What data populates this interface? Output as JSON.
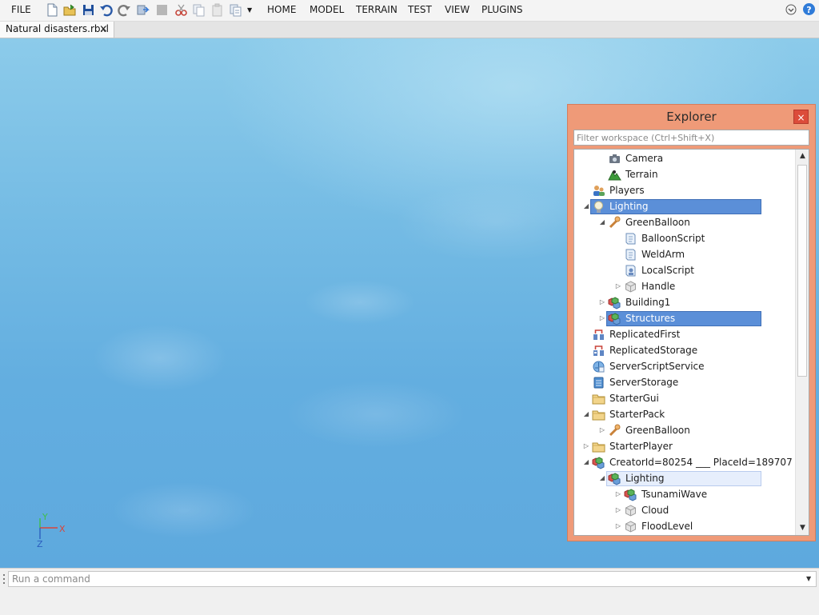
{
  "menubar": {
    "file": "FILE",
    "tabs": [
      "HOME",
      "MODEL",
      "TERRAIN",
      "TEST",
      "VIEW",
      "PLUGINS"
    ],
    "icons": [
      "new-file-icon",
      "open-folder-icon",
      "save-icon",
      "undo-icon",
      "redo-icon",
      "publish-icon",
      "stop-icon",
      "cut-icon",
      "copy-icon",
      "paste-icon",
      "duplicate-icon",
      "more-dropdown-icon"
    ],
    "right_icons": [
      "collapse-ribbon-icon",
      "help-icon"
    ],
    "help_color": "#2f7bd8"
  },
  "document_tab": {
    "label": "Natural disasters.rbxl",
    "close": "×"
  },
  "viewport": {
    "axes": {
      "x": "X",
      "y": "Y",
      "z": "Z"
    },
    "sky_color": "#6db5e2"
  },
  "explorer": {
    "title": "Explorer",
    "close": "×",
    "filter_placeholder": "Filter workspace (Ctrl+Shift+X)",
    "panel_color": "#ef9a78",
    "selection_color": "#5b8fd8",
    "items": [
      {
        "label": "Camera",
        "depth": 2,
        "arrow": "",
        "icon": "camera-icon",
        "state": ""
      },
      {
        "label": "Terrain",
        "depth": 2,
        "arrow": "",
        "icon": "terrain-icon",
        "state": ""
      },
      {
        "label": "Players",
        "depth": 1,
        "arrow": "",
        "icon": "players-icon",
        "state": ""
      },
      {
        "label": "Lighting",
        "depth": 1,
        "arrow": "down",
        "icon": "lighting-icon",
        "state": "selected"
      },
      {
        "label": "GreenBalloon",
        "depth": 2,
        "arrow": "down",
        "icon": "tool-icon",
        "state": ""
      },
      {
        "label": "BalloonScript",
        "depth": 3,
        "arrow": "",
        "icon": "script-icon",
        "state": ""
      },
      {
        "label": "WeldArm",
        "depth": 3,
        "arrow": "",
        "icon": "script-icon",
        "state": ""
      },
      {
        "label": "LocalScript",
        "depth": 3,
        "arrow": "",
        "icon": "local-script-icon",
        "state": ""
      },
      {
        "label": "Handle",
        "depth": 3,
        "arrow": "right",
        "icon": "part-icon",
        "state": ""
      },
      {
        "label": "Building1",
        "depth": 2,
        "arrow": "right",
        "icon": "model-icon",
        "state": ""
      },
      {
        "label": "Structures",
        "depth": 2,
        "arrow": "right",
        "icon": "model-icon",
        "state": "selected"
      },
      {
        "label": "ReplicatedFirst",
        "depth": 1,
        "arrow": "",
        "icon": "replicated-first-icon",
        "state": ""
      },
      {
        "label": "ReplicatedStorage",
        "depth": 1,
        "arrow": "",
        "icon": "replicated-storage-icon",
        "state": ""
      },
      {
        "label": "ServerScriptService",
        "depth": 1,
        "arrow": "",
        "icon": "server-script-service-icon",
        "state": ""
      },
      {
        "label": "ServerStorage",
        "depth": 1,
        "arrow": "",
        "icon": "server-storage-icon",
        "state": ""
      },
      {
        "label": "StarterGui",
        "depth": 1,
        "arrow": "",
        "icon": "folder-icon",
        "state": ""
      },
      {
        "label": "StarterPack",
        "depth": 1,
        "arrow": "down",
        "icon": "folder-icon",
        "state": ""
      },
      {
        "label": "GreenBalloon",
        "depth": 2,
        "arrow": "right",
        "icon": "tool-icon",
        "state": ""
      },
      {
        "label": "StarterPlayer",
        "depth": 1,
        "arrow": "right",
        "icon": "folder-icon",
        "state": ""
      },
      {
        "label": "CreatorId=80254 ___ PlaceId=189707",
        "depth": 1,
        "arrow": "down",
        "icon": "model-icon",
        "state": ""
      },
      {
        "label": "Lighting",
        "depth": 2,
        "arrow": "down",
        "icon": "model-icon",
        "state": "hover"
      },
      {
        "label": "TsunamiWave",
        "depth": 3,
        "arrow": "right",
        "icon": "model-icon",
        "state": ""
      },
      {
        "label": "Cloud",
        "depth": 3,
        "arrow": "right",
        "icon": "part-icon",
        "state": ""
      },
      {
        "label": "FloodLevel",
        "depth": 3,
        "arrow": "right",
        "icon": "part-icon",
        "state": ""
      }
    ]
  },
  "command_bar": {
    "placeholder": "Run a command"
  }
}
